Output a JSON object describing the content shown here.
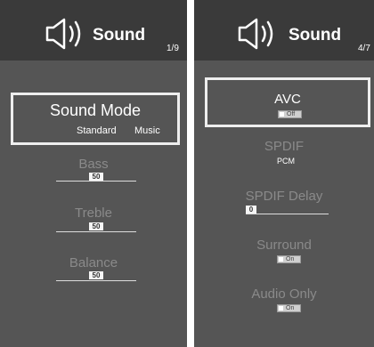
{
  "left_screen": {
    "title": "Sound",
    "page": "1/9",
    "selected_item": {
      "label": "Sound Mode",
      "options": [
        "Standard",
        "Music"
      ]
    },
    "sliders": [
      {
        "label": "Bass",
        "value": "50"
      },
      {
        "label": "Treble",
        "value": "50"
      },
      {
        "label": "Balance",
        "value": "50"
      }
    ]
  },
  "right_screen": {
    "title": "Sound",
    "page": "4/7",
    "avc": {
      "label": "AVC",
      "state": "Off"
    },
    "spdif": {
      "label": "SPDIF",
      "value": "PCM"
    },
    "spdif_delay": {
      "label": "SPDIF Delay",
      "value": "0"
    },
    "surround": {
      "label": "Surround",
      "state": "On"
    },
    "audio_only": {
      "label": "Audio Only",
      "state": "On"
    }
  },
  "icons": {
    "header": "speaker-icon"
  },
  "colors": {
    "background": "#555555",
    "header": "#3a3a3a",
    "selected_border": "#eeeeee",
    "inactive_text": "#8a8a8a"
  }
}
